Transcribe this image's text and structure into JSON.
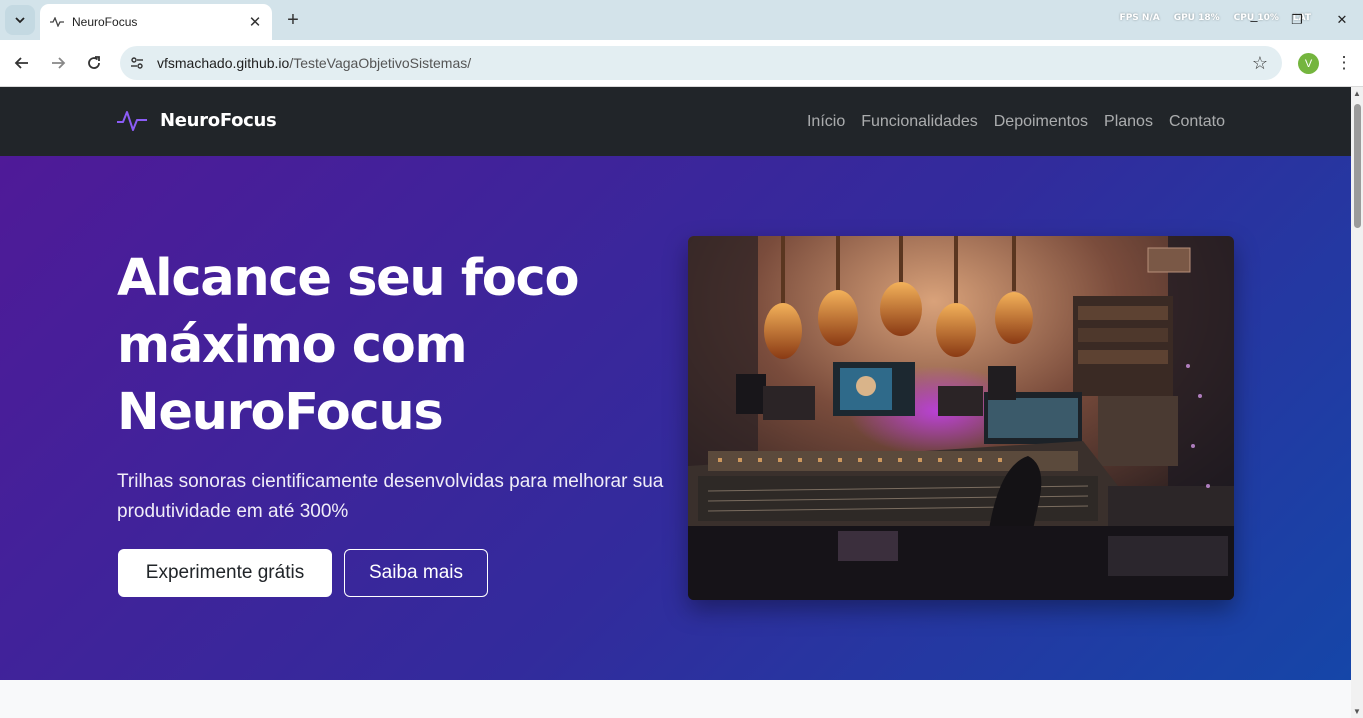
{
  "browser": {
    "tab_title": "NeuroFocus",
    "url_domain": "vfsmachado.github.io",
    "url_path": "/TesteVagaObjetivoSistemas/",
    "profile_initial": "V",
    "overlay": {
      "fps": "FPS  N/A",
      "gpu": "GPU  18%",
      "cpu": "CPU  10%",
      "lat": "LAT"
    }
  },
  "site": {
    "brand": "NeuroFocus",
    "brand_color": "#6f42c1",
    "nav": [
      {
        "label": "Início"
      },
      {
        "label": "Funcionalidades"
      },
      {
        "label": "Depoimentos"
      },
      {
        "label": "Planos"
      },
      {
        "label": "Contato"
      }
    ]
  },
  "hero": {
    "headline": "Alcance seu foco máximo com NeuroFocus",
    "subtitle": "Trilhas sonoras cientificamente desenvolvidas para melhorar sua produtividade em até 300%",
    "primary_button": "Experimente grátis",
    "secondary_button": "Saiba mais",
    "image_subject": "music studio with guitars on the wall and a mixing console"
  }
}
